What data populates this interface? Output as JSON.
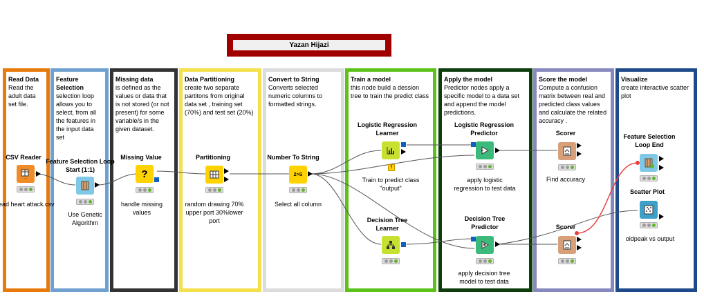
{
  "title": "Yazan Hijazi",
  "annotations": [
    {
      "id": "read",
      "title": "Read Data",
      "text": "Read the adult data set file.",
      "color": "#e8790a"
    },
    {
      "id": "fs",
      "title": "Feature Selection",
      "text": "selection loop allows you to select, from all the features in the input data set",
      "color": "#6fa0d0"
    },
    {
      "id": "md",
      "title": "Missing data",
      "text": "is defined as the values or data that is not stored (or not present) for some variable/s in the given dataset.",
      "color": "#333333"
    },
    {
      "id": "dp",
      "title": "Data Partitioning",
      "text": "create two separate partitons from original data set , training set (70%) and test set (20%)",
      "color": "#f4e04a"
    },
    {
      "id": "cs",
      "title": "Convert to String",
      "text": "Converts selected numeric columns to formatted strings.",
      "color": "#dcdcdc"
    },
    {
      "id": "tm",
      "title": "Train a model",
      "text": "this node build a dession tree to train the predict class",
      "color": "#5cc21a"
    },
    {
      "id": "am",
      "title": "Apply the model",
      "text": "Predictor nodes apply a specific model to a data set and append the model predictions.",
      "color": "#0d3d0d"
    },
    {
      "id": "sm",
      "title": "Score the model",
      "text": "Compute a confusion matrix between real and predicted class values and calculate the related accuracy .",
      "color": "#8888c0"
    },
    {
      "id": "vz",
      "title": "Visualize",
      "text": "create interactive scatter plot",
      "color": "#1e4a8a"
    }
  ],
  "nodes": [
    {
      "id": "csv",
      "label": "CSV Reader",
      "desc": "Read heart attack.csv",
      "color": "#f08c28",
      "icon": "table-reader-icon"
    },
    {
      "id": "fsl",
      "label": "Feature Selection Loop Start (1:1)",
      "desc": "Use Genetic Algorithm",
      "color": "#7fc8e8",
      "icon": "loop-start-icon"
    },
    {
      "id": "mv",
      "label": "Missing Value",
      "desc": "handle missing values",
      "color": "#ffd200",
      "icon": "question-mark-icon"
    },
    {
      "id": "part",
      "label": "Partitioning",
      "desc": "random drawing 70% upper port 30%lower port",
      "color": "#ffd200",
      "icon": "partition-icon"
    },
    {
      "id": "nts",
      "label": "Number To String",
      "desc": "Select all column",
      "color": "#ffd200",
      "icon": "number-to-string-icon"
    },
    {
      "id": "lrl",
      "label": "Logistic Regression Learner",
      "desc": "Train to predict class \"output\"",
      "color": "#c8e030",
      "icon": "learner-icon"
    },
    {
      "id": "dtl",
      "label": "Decision Tree Learner",
      "desc": "",
      "color": "#c8e030",
      "icon": "tree-learner-icon"
    },
    {
      "id": "lrp",
      "label": "Logistic Regression Predictor",
      "desc": "apply logistic regression to test data",
      "color": "#3cba7c",
      "icon": "predictor-icon"
    },
    {
      "id": "dtp",
      "label": "Decision Tree Predictor",
      "desc": "apply decision tree model to test data",
      "color": "#3cba7c",
      "icon": "tree-predictor-icon"
    },
    {
      "id": "sc1",
      "label": "Scorer",
      "desc": "Find accuracy",
      "color": "#d8a078",
      "icon": "scorer-icon"
    },
    {
      "id": "sc2",
      "label": "Scorer",
      "desc": "",
      "color": "#d8a078",
      "icon": "scorer-icon"
    },
    {
      "id": "fse",
      "label": "Feature Selection Loop End",
      "desc": "",
      "color": "#7fc8e8",
      "icon": "loop-end-icon"
    },
    {
      "id": "sp",
      "label": "Scatter Plot",
      "desc": "oldpeak vs output",
      "color": "#3ca0c8",
      "icon": "scatter-plot-icon"
    }
  ],
  "warn_symbol": "!",
  "number_to_string_glyph": "2>S"
}
